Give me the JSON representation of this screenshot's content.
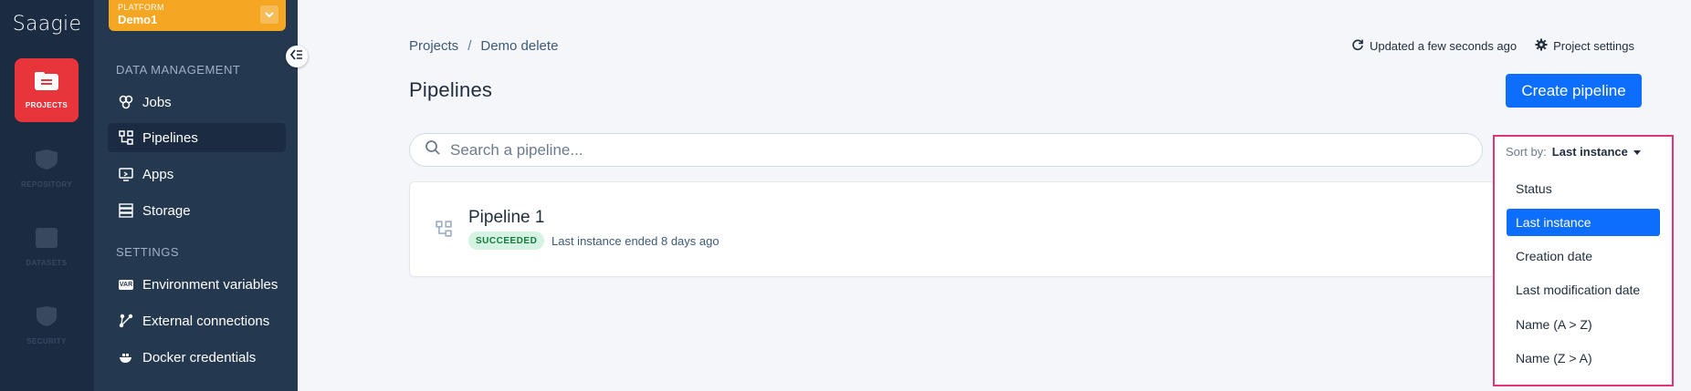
{
  "app": {
    "logo": "Saagie"
  },
  "rail": {
    "projects_label": "PROJECTS",
    "dim_labels": [
      "REPOSITORY",
      "DATASETS",
      "SECURITY"
    ]
  },
  "platform": {
    "label": "PLATFORM",
    "name": "Demo1"
  },
  "sidebar": {
    "data_management_title": "DATA MANAGEMENT",
    "items": [
      {
        "label": "Jobs",
        "icon": "jobs-icon"
      },
      {
        "label": "Pipelines",
        "icon": "pipelines-icon",
        "active": true
      },
      {
        "label": "Apps",
        "icon": "apps-icon"
      },
      {
        "label": "Storage",
        "icon": "storage-icon"
      }
    ],
    "settings_title": "SETTINGS",
    "settings_items": [
      {
        "label": "Environment variables",
        "icon": "var-icon",
        "icon_text": "VAR"
      },
      {
        "label": "External connections",
        "icon": "connections-icon"
      },
      {
        "label": "Docker credentials",
        "icon": "docker-icon"
      }
    ]
  },
  "breadcrumb": {
    "root": "Projects",
    "separator": "/",
    "current": "Demo delete"
  },
  "header": {
    "updated": "Updated a few seconds ago",
    "settings": "Project settings",
    "title": "Pipelines",
    "create_button": "Create pipeline"
  },
  "search": {
    "placeholder": "Search a pipeline...",
    "value": ""
  },
  "pipelines": [
    {
      "name": "Pipeline 1",
      "status": "SUCCEEDED",
      "meta": "Last instance ended 8 days ago"
    }
  ],
  "sort": {
    "label": "Sort by:",
    "value": "Last instance",
    "options": [
      "Status",
      "Last instance",
      "Creation date",
      "Last modification date",
      "Name (A > Z)",
      "Name (Z > A)"
    ],
    "selected_index": 1
  },
  "colors": {
    "accent": "#0d6efd",
    "rail": "#1a2b42",
    "sidebar": "#24384f",
    "projects_active": "#e8343b",
    "platform": "#f5a623",
    "success_bg": "#d4f3e2",
    "highlight_border": "#e0357a"
  }
}
